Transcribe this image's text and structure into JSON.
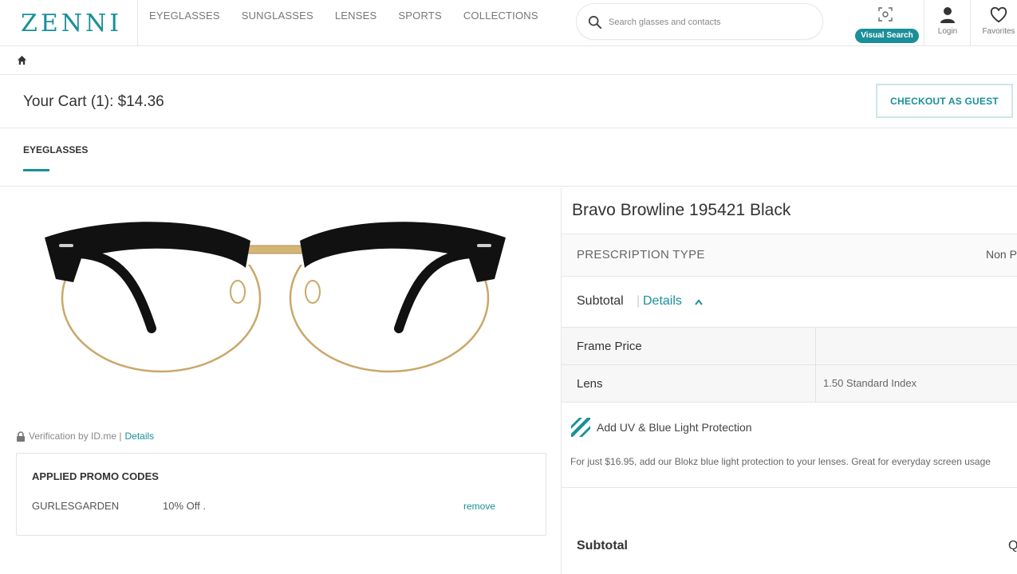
{
  "header": {
    "logo": "ZENNI",
    "nav": [
      "EYEGLASSES",
      "SUNGLASSES",
      "LENSES",
      "SPORTS",
      "COLLECTIONS"
    ],
    "search_placeholder": "Search glasses and contacts",
    "visual_search_label": "Visual Search",
    "login_label": "Login",
    "favorites_label": "Favorites"
  },
  "cart": {
    "title": "Your Cart (1): $14.36",
    "checkout_button": "CHECKOUT AS GUEST",
    "tab_label": "EYEGLASSES"
  },
  "left": {
    "verification_text": "Verification by ID.me |",
    "verification_link": "Details",
    "promo": {
      "heading": "APPLIED PROMO CODES",
      "code": "GURLESGARDEN",
      "discount": "10% Off .",
      "remove_label": "remove"
    }
  },
  "product": {
    "name": "Bravo Browline 195421 Black",
    "prescription_type_label": "PRESCRIPTION TYPE",
    "prescription_type_value": "Non Pr",
    "subtotal_label": "Subtotal",
    "details_link": "Details",
    "price_rows": [
      {
        "label": "Frame Price",
        "value": ""
      },
      {
        "label": "Lens",
        "value": "1.50 Standard Index"
      }
    ],
    "uv_title": "Add UV & Blue Light Protection",
    "uv_description": "For just $16.95, add our Blokz blue light protection to your lenses. Great for everyday screen usage",
    "subtotal2_label": "Subtotal",
    "subtotal2_value": "Q"
  },
  "colors": {
    "accent": "#1a8f99",
    "text": "#333333",
    "border": "#e6e6e6"
  }
}
